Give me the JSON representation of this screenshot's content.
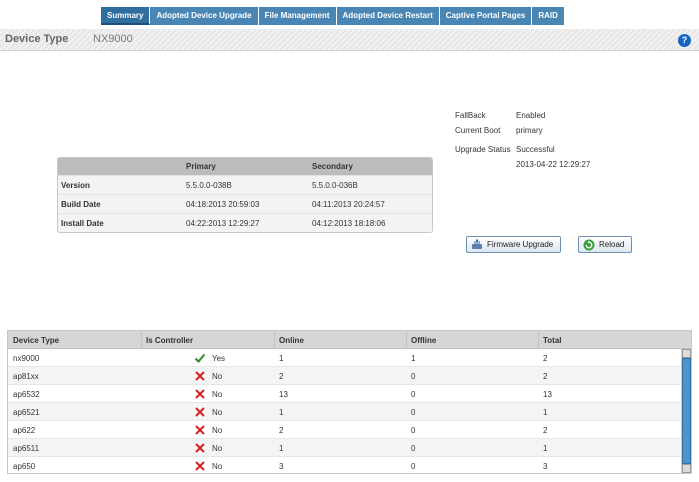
{
  "tabs": [
    "Summary",
    "Adopted Device Upgrade",
    "File Management",
    "Adopted Device Restart",
    "Captive Portal Pages",
    "RAID"
  ],
  "header": {
    "label": "Device Type",
    "value": "NX9000",
    "help": "?"
  },
  "info": {
    "fallback_label": "FallBack",
    "fallback_value": "Enabled",
    "current_boot_label": "Current Boot",
    "current_boot_value": "primary",
    "upgrade_status_label": "Upgrade Status",
    "upgrade_status_value": "Successful",
    "upgrade_time": "2013-04-22 12:29:27"
  },
  "version_table": {
    "headers": [
      "Primary",
      "Secondary"
    ],
    "rows": [
      {
        "label": "Version",
        "primary": "5.5.0.0-038B",
        "secondary": "5.5.0.0-036B"
      },
      {
        "label": "Build Date",
        "primary": "04:18:2013 20:59:03",
        "secondary": "04:11:2013 20:24:57"
      },
      {
        "label": "Install Date",
        "primary": "04:22:2013 12:29:27",
        "secondary": "04:12:2013 18:18:06"
      }
    ]
  },
  "buttons": {
    "firmware_upgrade": "Firmware Upgrade",
    "reload": "Reload"
  },
  "device_table": {
    "headers": [
      "Device Type",
      "Is Controller",
      "Online",
      "Offline",
      "Total"
    ],
    "rows": [
      {
        "type": "nx9000",
        "controller": "Yes",
        "online": "1",
        "offline": "1",
        "total": "2"
      },
      {
        "type": "ap81xx",
        "controller": "No",
        "online": "2",
        "offline": "0",
        "total": "2"
      },
      {
        "type": "ap6532",
        "controller": "No",
        "online": "13",
        "offline": "0",
        "total": "13"
      },
      {
        "type": "ap6521",
        "controller": "No",
        "online": "1",
        "offline": "0",
        "total": "1"
      },
      {
        "type": "ap622",
        "controller": "No",
        "online": "2",
        "offline": "0",
        "total": "2"
      },
      {
        "type": "ap6511",
        "controller": "No",
        "online": "1",
        "offline": "0",
        "total": "1"
      },
      {
        "type": "ap650",
        "controller": "No",
        "online": "3",
        "offline": "0",
        "total": "3"
      }
    ]
  },
  "colors": {
    "tab": "#4a86b4",
    "check": "#2e8b2e",
    "cross": "#d62020",
    "accent": "#4f93c9"
  }
}
